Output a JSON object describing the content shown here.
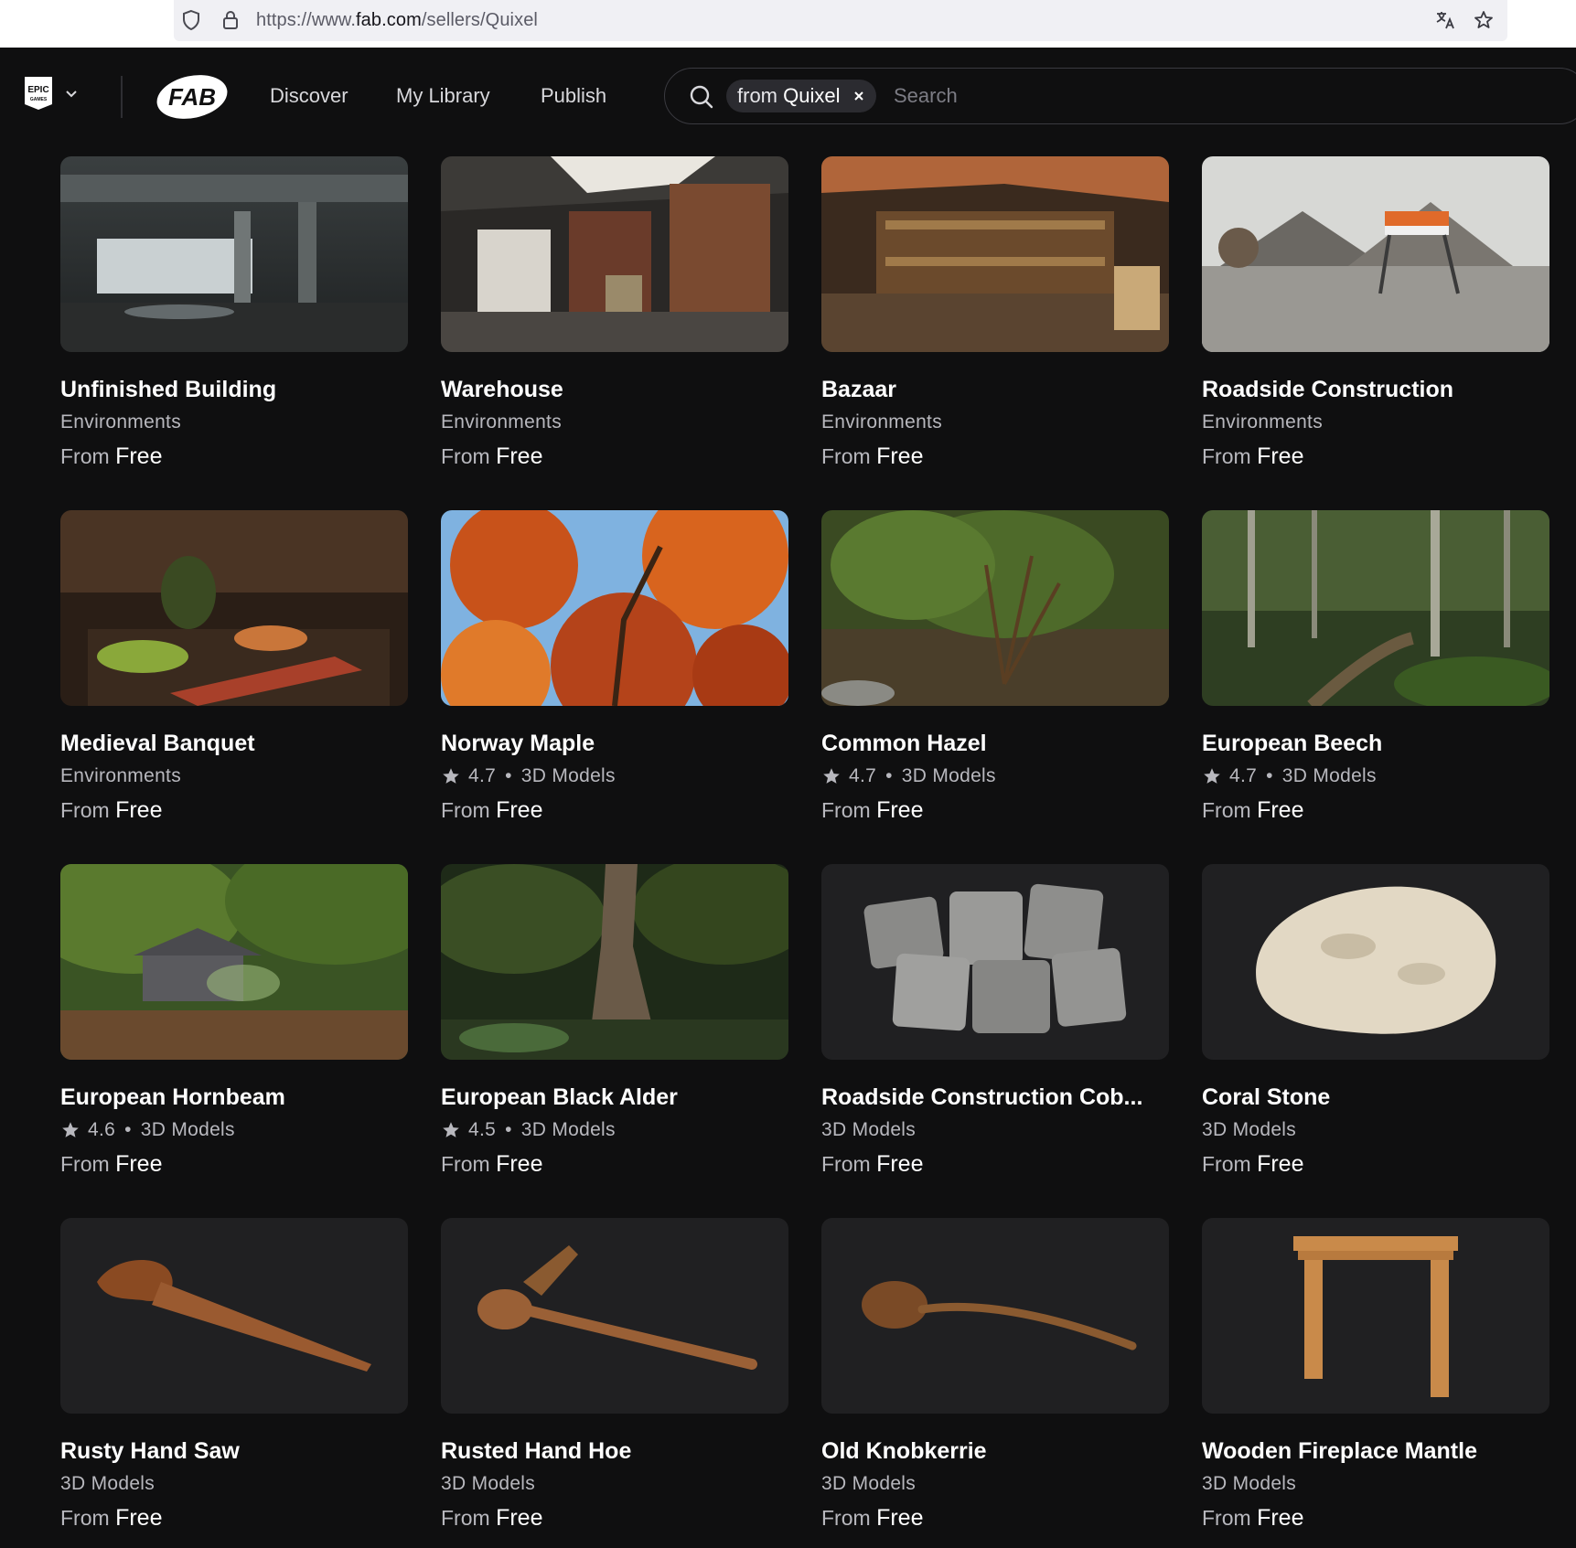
{
  "browser": {
    "url_prefix": "https://www.",
    "url_host": "fab.com",
    "url_path": "/sellers/Quixel"
  },
  "header": {
    "nav": [
      {
        "label": "Discover"
      },
      {
        "label": "My Library"
      },
      {
        "label": "Publish"
      }
    ],
    "search": {
      "chip_prefix": "from",
      "chip_seller": "Quixel",
      "chip_close": "×",
      "placeholder": "Search"
    }
  },
  "colors": {
    "background": "#0f0f10",
    "card_placeholder": "#202022",
    "text_primary": "#ffffff",
    "text_secondary": "#b8b8be"
  },
  "price_prefix": "From",
  "products": [
    {
      "title": "Unfinished Building",
      "category": "Environments",
      "price": "Free",
      "thumb": "unfinished-building"
    },
    {
      "title": "Warehouse",
      "category": "Environments",
      "price": "Free",
      "thumb": "warehouse"
    },
    {
      "title": "Bazaar",
      "category": "Environments",
      "price": "Free",
      "thumb": "bazaar"
    },
    {
      "title": "Roadside Construction",
      "category": "Environments",
      "price": "Free",
      "thumb": "roadside-construction"
    },
    {
      "title": "Medieval Banquet",
      "category": "Environments",
      "price": "Free",
      "thumb": "medieval-banquet"
    },
    {
      "title": "Norway Maple",
      "rating": "4.7",
      "category": "3D Models",
      "price": "Free",
      "thumb": "norway-maple"
    },
    {
      "title": "Common Hazel",
      "rating": "4.7",
      "category": "3D Models",
      "price": "Free",
      "thumb": "common-hazel"
    },
    {
      "title": "European Beech",
      "rating": "4.7",
      "category": "3D Models",
      "price": "Free",
      "thumb": "european-beech"
    },
    {
      "title": "European Hornbeam",
      "rating": "4.6",
      "category": "3D Models",
      "price": "Free",
      "thumb": "european-hornbeam"
    },
    {
      "title": "European Black Alder",
      "rating": "4.5",
      "category": "3D Models",
      "price": "Free",
      "thumb": "european-black-alder"
    },
    {
      "title": "Roadside Construction Cob...",
      "category": "3D Models",
      "price": "Free",
      "thumb": "cobblestones"
    },
    {
      "title": "Coral Stone",
      "category": "3D Models",
      "price": "Free",
      "thumb": "coral-stone"
    },
    {
      "title": "Rusty Hand Saw",
      "category": "3D Models",
      "price": "Free",
      "thumb": "hand-saw"
    },
    {
      "title": "Rusted Hand Hoe",
      "category": "3D Models",
      "price": "Free",
      "thumb": "hand-hoe"
    },
    {
      "title": "Old Knobkerrie",
      "category": "3D Models",
      "price": "Free",
      "thumb": "knobkerrie"
    },
    {
      "title": "Wooden Fireplace Mantle",
      "category": "3D Models",
      "price": "Free",
      "thumb": "fireplace-mantle"
    }
  ]
}
